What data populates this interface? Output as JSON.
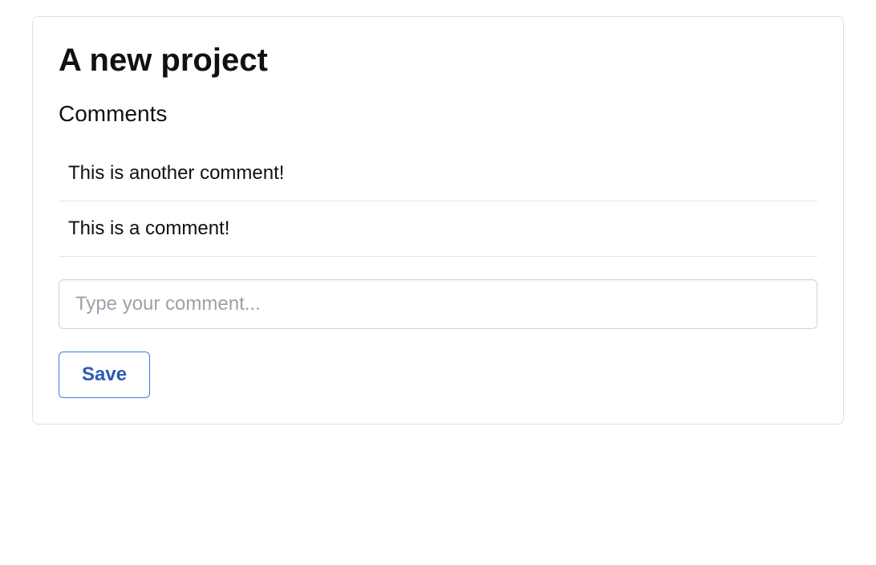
{
  "project": {
    "title": "A new project"
  },
  "comments": {
    "heading": "Comments",
    "items": [
      {
        "text": "This is another comment!"
      },
      {
        "text": "This is a comment!"
      }
    ],
    "input_placeholder": "Type your comment...",
    "save_label": "Save"
  }
}
